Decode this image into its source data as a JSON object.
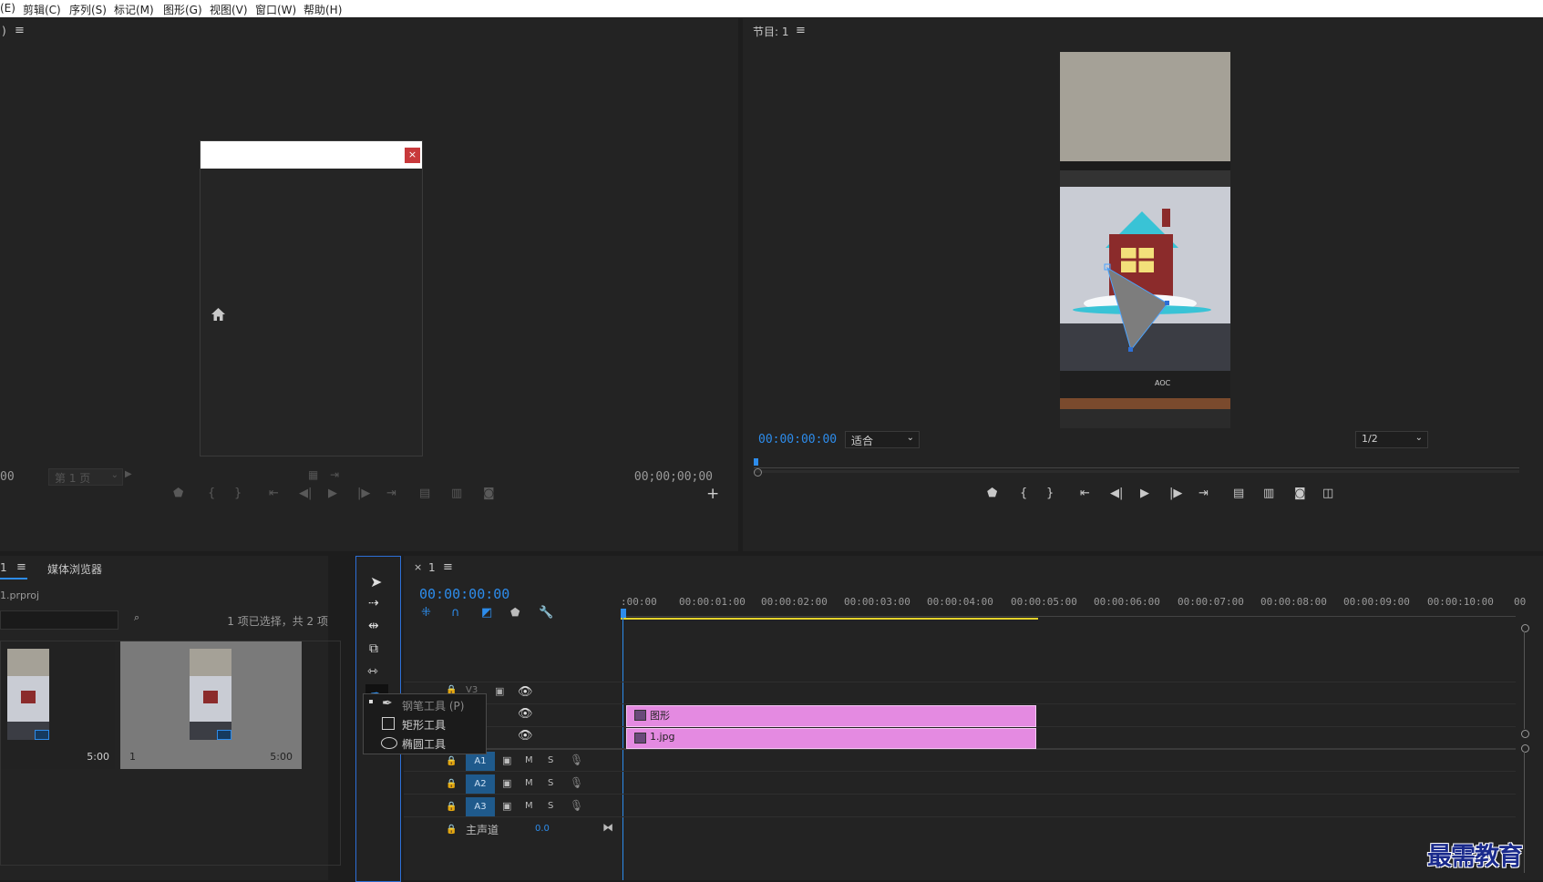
{
  "menu": [
    "(E)",
    "剪辑(C)",
    "序列(S)",
    "标记(M)",
    "图形(G)",
    "视图(V)",
    "窗口(W)",
    "帮助(H)"
  ],
  "source_monitor": {
    "header": ")",
    "page_select": "第 1 页",
    "left_timecode": "00",
    "right_timecode": "00;00;00;00",
    "dialog_close": "×"
  },
  "program_monitor": {
    "title": "节目: 1",
    "timecode": "00:00:00:00",
    "fit": "适合",
    "resolution": "1/2"
  },
  "project_panel": {
    "tab": "1",
    "tab_media": "媒体浏览器",
    "file": "1.prproj",
    "selection_info": "1 项已选择，共 2 项",
    "items": [
      {
        "name": "",
        "duration": "5:00"
      },
      {
        "name": "1",
        "duration": "5:00"
      }
    ]
  },
  "timeline": {
    "tab": "1",
    "timecode": "00:00:00:00",
    "ruler": [
      ":00:00",
      "00:00:01:00",
      "00:00:02:00",
      "00:00:03:00",
      "00:00:04:00",
      "00:00:05:00",
      "00:00:06:00",
      "00:00:07:00",
      "00:00:08:00",
      "00:00:09:00",
      "00:00:10:00",
      "00"
    ],
    "audio_tracks": [
      {
        "name": "A1",
        "m": "M",
        "s": "S"
      },
      {
        "name": "A2",
        "m": "M",
        "s": "S"
      },
      {
        "name": "A3",
        "m": "M",
        "s": "S"
      }
    ],
    "master": {
      "label": "主声道",
      "value": "0.0"
    },
    "clips": [
      {
        "name": "图形"
      },
      {
        "name": "1.jpg"
      }
    ],
    "track_fragment": "V3"
  },
  "tool_flyout": {
    "items": [
      {
        "label": "钢笔工具 (P)"
      },
      {
        "label": "矩形工具"
      },
      {
        "label": "椭圆工具"
      }
    ]
  },
  "watermark": "最需教育",
  "colors": {
    "accent": "#2d8ceb",
    "clip": "#e48ae1",
    "track_badge": "#1f5a8c",
    "work_area": "#e3d22a",
    "watermark": "#1a2a8c"
  }
}
